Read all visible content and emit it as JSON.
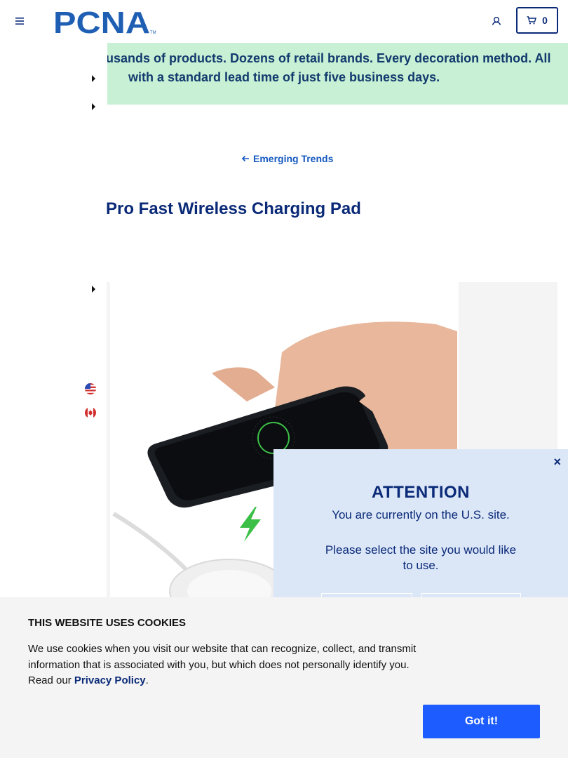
{
  "brand": {
    "logo_text": "PCNA",
    "logo_tm": "TM",
    "color": "#1f5fb3"
  },
  "header": {
    "cart_count": "0"
  },
  "banner": {
    "line1": "usands of products. Dozens of retail brands. Every decoration method. All",
    "line2": "with a standard lead time of just five business days."
  },
  "nav": {
    "back_label": "Emerging Trends"
  },
  "product": {
    "title": "Pro Fast Wireless Charging Pad"
  },
  "regions": [
    "us-flag",
    "canada-flag"
  ],
  "modal": {
    "title": "ATTENTION",
    "message": "You are currently on the U.S. site.",
    "prompt": "Please select the site you would like to use.",
    "close_label": "×"
  },
  "cookie": {
    "title": "THIS WEBSITE USES COOKIES",
    "body": "We use cookies when you visit our website that can recognize, collect, and transmit information that is associated with you, but which does not personally identify you. Read our",
    "link": "Privacy Policy",
    "period": ".",
    "button": "Got it!"
  },
  "colors": {
    "navy": "#0a2a78",
    "banner_bg": "#c8f0d4",
    "modal_bg": "#dbe6f7",
    "cookie_btn": "#1d5cff",
    "link": "#1559c0"
  }
}
